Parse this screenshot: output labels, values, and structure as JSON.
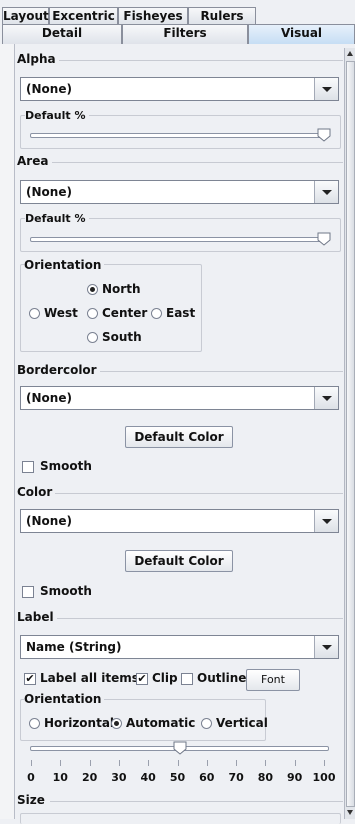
{
  "tabs_row1": [
    "Layout",
    "Excentric",
    "Fisheyes",
    "Rulers"
  ],
  "tabs_row2": [
    "Detail",
    "Filters",
    "Visual"
  ],
  "selected_tab": "Visual",
  "alpha": {
    "title": "Alpha",
    "select_value": "(None)",
    "default_label": "Default %",
    "default_percent": 100
  },
  "area": {
    "title": "Area",
    "select_value": "(None)",
    "default_label": "Default %",
    "default_percent": 100,
    "orientation": {
      "title": "Orientation",
      "north": "North",
      "west": "West",
      "center": "Center",
      "east": "East",
      "south": "South",
      "selected": "North"
    }
  },
  "bordercolor": {
    "title": "Bordercolor",
    "select_value": "(None)",
    "button": "Default Color",
    "smooth_label": "Smooth",
    "smooth_checked": false
  },
  "color": {
    "title": "Color",
    "select_value": "(None)",
    "button": "Default Color",
    "smooth_label": "Smooth",
    "smooth_checked": false
  },
  "label": {
    "title": "Label",
    "select_value": "Name (String)",
    "label_all_items": "Label all items",
    "label_all_items_checked": true,
    "clip": "Clip",
    "clip_checked": true,
    "outline": "Outline",
    "outline_checked": false,
    "font_button": "Font",
    "orientation": {
      "title": "Orientation",
      "horizontal": "Horizontal",
      "automatic": "Automatic",
      "vertical": "Vertical",
      "selected": "Automatic"
    },
    "slider_value": 50,
    "ticks": [
      "0",
      "10",
      "20",
      "30",
      "40",
      "50",
      "60",
      "70",
      "80",
      "90",
      "100"
    ]
  },
  "size": {
    "title": "Size"
  },
  "colors": {
    "selected_tab": "#c6def4",
    "panel": "#eef0f4"
  }
}
